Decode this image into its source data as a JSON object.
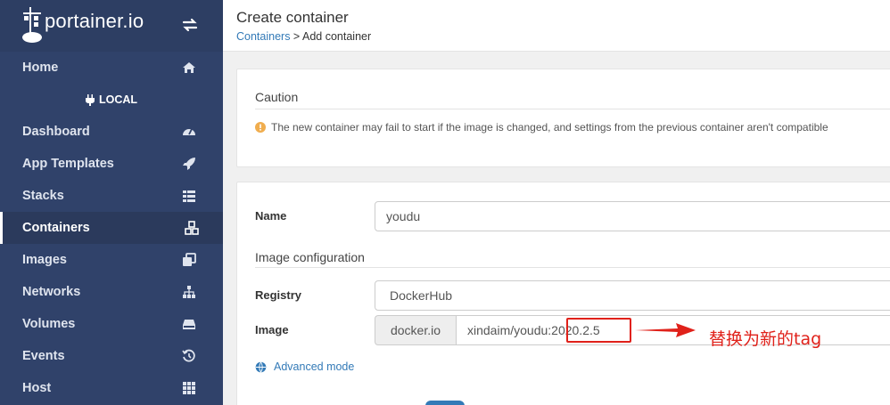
{
  "app": {
    "brand": "portainer.io"
  },
  "sidebar": {
    "endpoint": "LOCAL",
    "items": [
      {
        "label": "Home",
        "icon": "home-icon"
      },
      {
        "label": "Dashboard",
        "icon": "dashboard-icon"
      },
      {
        "label": "App Templates",
        "icon": "rocket-icon"
      },
      {
        "label": "Stacks",
        "icon": "th-list-icon"
      },
      {
        "label": "Containers",
        "icon": "cubes-icon",
        "active": true
      },
      {
        "label": "Images",
        "icon": "clone-icon"
      },
      {
        "label": "Networks",
        "icon": "sitemap-icon"
      },
      {
        "label": "Volumes",
        "icon": "hdd-icon"
      },
      {
        "label": "Events",
        "icon": "history-icon"
      },
      {
        "label": "Host",
        "icon": "th-icon"
      }
    ]
  },
  "header": {
    "title": "Create container",
    "breadcrumb_link": "Containers",
    "breadcrumb_rest": " > Add container"
  },
  "caution": {
    "title": "Caution",
    "message": "The new container may fail to start if the image is changed, and settings from the previous container aren't compatible"
  },
  "form": {
    "name_label": "Name",
    "name_value": "youdu",
    "image_section_title": "Image configuration",
    "registry_label": "Registry",
    "registry_value": "DockerHub",
    "image_label": "Image",
    "image_prefix": "docker.io",
    "image_value": "xindaim/youdu:2020.2.5",
    "advanced_mode": "Advanced mode"
  },
  "annotation": {
    "text": "替换为新的tag",
    "color": "#e0211a"
  },
  "colors": {
    "sidebar_bg": "#30426a",
    "link": "#337ab7",
    "warning": "#f0ad4e"
  }
}
